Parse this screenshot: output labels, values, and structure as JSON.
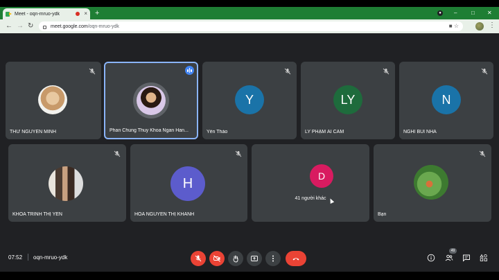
{
  "browser": {
    "tab_title": "Meet - oqn-mruo-ydk",
    "tab_close": "×",
    "new_tab": "+",
    "window_controls": [
      "–",
      "□",
      "✕"
    ],
    "url_host": "meet.google.com",
    "url_path": "/oqn-mruo-ydk",
    "nav_icons": [
      "arrow-left-icon",
      "arrow-right-icon",
      "reload-icon"
    ]
  },
  "tiles_row1": [
    {
      "name": "THƯ NGUYỄN MINH",
      "avatar_type": "photo",
      "muted": true
    },
    {
      "name": "Phan Chung Thuy Khoa Ngan Han...",
      "avatar_type": "photo",
      "muted": false,
      "speaking": true
    },
    {
      "name": "Yến Thảo",
      "avatar_type": "letter",
      "letter": "Y",
      "color": "#1a73a8",
      "muted": true
    },
    {
      "name": "LY PHẠM ÁI CẦM",
      "avatar_type": "letter",
      "letter": "LY",
      "color": "#1e6b3c",
      "muted": true
    },
    {
      "name": "NGHI BÙI NHÃ",
      "avatar_type": "letter",
      "letter": "N",
      "color": "#1a73a8",
      "muted": true
    }
  ],
  "tiles_row2": [
    {
      "name": "KHOA TRÌNH THỊ YẾN",
      "avatar_type": "photo",
      "muted": true
    },
    {
      "name": "HÒA NGUYỄN THỊ KHÁNH",
      "avatar_type": "letter",
      "letter": "H",
      "color": "#5c5ccc",
      "muted": true
    },
    {
      "name": "",
      "others_text": "41 người khác",
      "avatar_type": "letter",
      "letter": "D",
      "color": "#d81b60",
      "muted": false
    },
    {
      "name": "Bạn",
      "avatar_type": "photo",
      "muted": true
    }
  ],
  "bottom": {
    "time": "07:52",
    "meeting_code": "oqn-mruo-ydk",
    "participant_count": "49"
  },
  "colors": {
    "background": "#202124",
    "tile": "#3c4043",
    "active_border": "#8ab4f8",
    "control_red": "#ea4335"
  }
}
